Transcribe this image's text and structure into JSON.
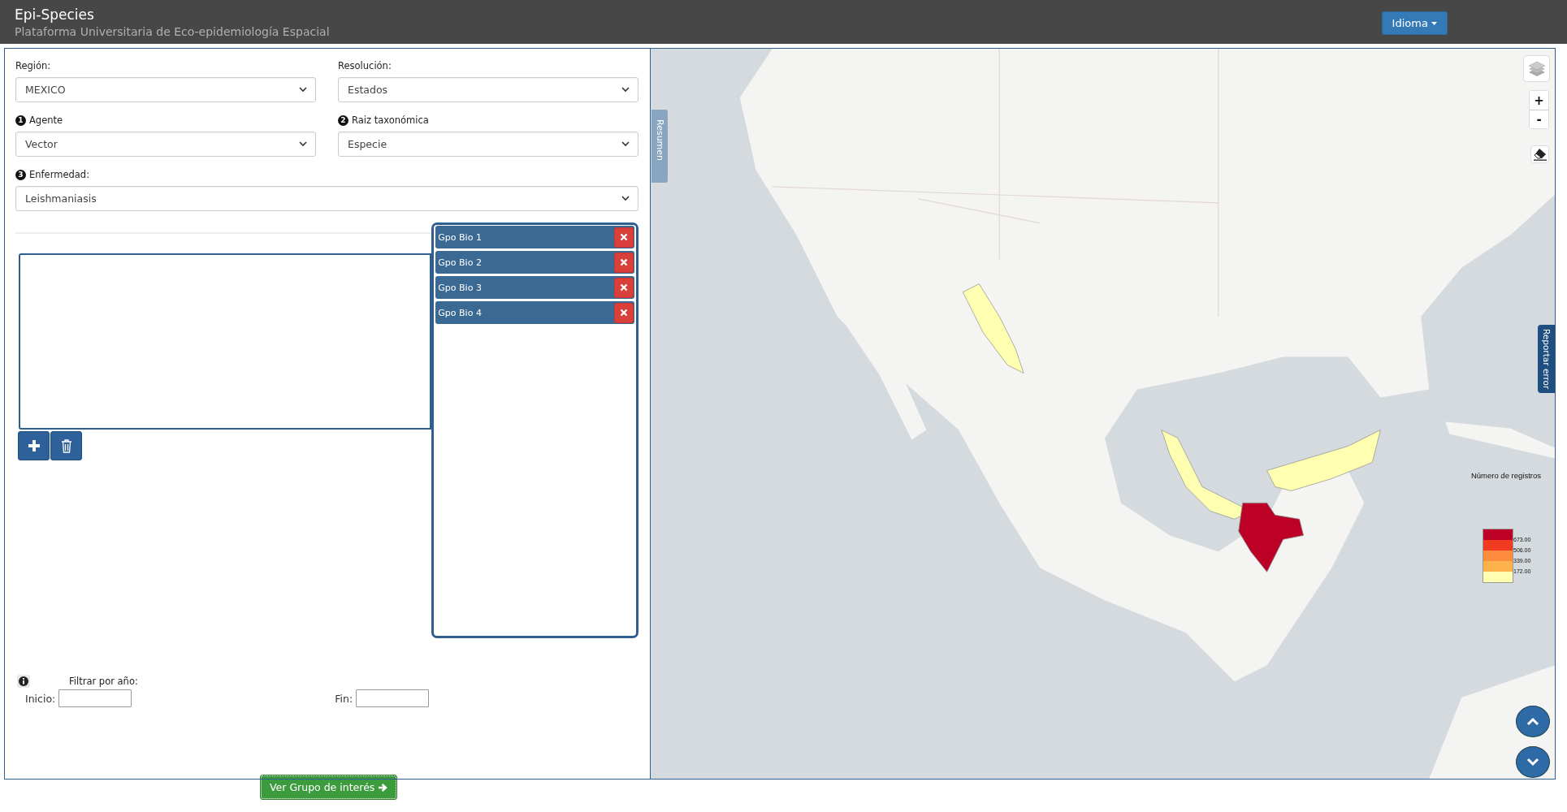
{
  "header": {
    "title": "Epi-Species",
    "subtitle": "Plataforma Universitaria de Eco-epidemiología Espacial",
    "language_button": "Idioma"
  },
  "form": {
    "fields": [
      {
        "label": "Región:",
        "value": "MEXICO",
        "kind": "half"
      },
      {
        "label": "Resolución:",
        "value": "Estados",
        "kind": "half"
      },
      {
        "label": "Agente",
        "value": "Vector",
        "step": "1",
        "kind": "half"
      },
      {
        "label": "Raiz taxonómica",
        "value": "Especie",
        "step": "2",
        "kind": "half"
      },
      {
        "label": "Enfermedad:",
        "value": "Leishmaniasis",
        "step": "3",
        "kind": "full"
      }
    ]
  },
  "groups": [
    {
      "label": "Gpo Bio 1"
    },
    {
      "label": "Gpo Bio 2"
    },
    {
      "label": "Gpo Bio 3"
    },
    {
      "label": "Gpo Bio 4"
    }
  ],
  "year_filter": {
    "title": "Filtrar por año:",
    "start_label": "Inicio:",
    "end_label": "Fin:"
  },
  "submit_button": "Ver Grupo de interés",
  "map": {
    "side_tab": "Resumen",
    "report_tab": "Reportar error",
    "zoom_in": "+",
    "zoom_out": "-",
    "legend": {
      "title": "Número de registros",
      "entries": [
        {
          "color": "#bd0026",
          "label": "673.00"
        },
        {
          "color": "#f03b20",
          "label": "506.00"
        },
        {
          "color": "#fd8d3c",
          "label": "339.00"
        },
        {
          "color": "#feb24c",
          "label": "172.00"
        },
        {
          "color": "#ffffb2"
        }
      ]
    }
  }
}
